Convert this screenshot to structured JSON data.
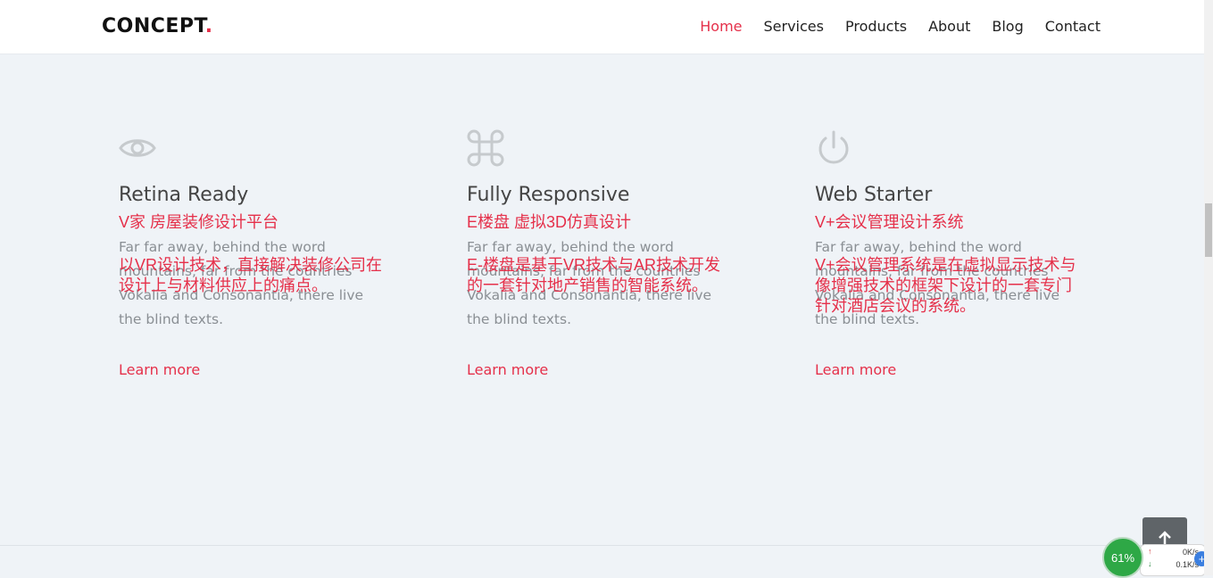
{
  "navbar": {
    "logo_text": "CONCEPT",
    "logo_dot": ".",
    "links": [
      "Home",
      "Services",
      "Products",
      "About",
      "Blog",
      "Contact"
    ],
    "active": "Home"
  },
  "features": [
    {
      "icon": "eye-icon",
      "title": "Retina Ready",
      "cn_title": "V家 房屋装修设计平台",
      "desc": "Far far away, behind the word mountains, far from the countries Vokalia and Consonantia, there live the blind texts.",
      "cn_desc": "以VR设计技术，直接解决装修公司在设计上与材料供应上的痛点。",
      "link": "Learn more"
    },
    {
      "icon": "command-icon",
      "title": "Fully Responsive",
      "cn_title": "E楼盘 虚拟3D仿真设计",
      "desc": "Far far away, behind the word mountains, far from the countries Vokalia and Consonantia, there live the blind texts.",
      "cn_desc": "E-楼盘是基于VR技术与AR技术开发的一套针对地产销售的智能系统。",
      "link": "Learn more"
    },
    {
      "icon": "power-icon",
      "title": "Web Starter",
      "cn_title": "V+会议管理设计系统",
      "desc": "Far far away, behind the word mountains, far from the countries Vokalia and Consonantia, there live the blind texts.",
      "cn_desc": "V+会议管理系统是在虚拟显示技术与像增强技术的框架下设计的一套专门针对酒店会议的系统。",
      "link": "Learn more"
    }
  ],
  "widget": {
    "percent": "61%",
    "upload": "0K/s",
    "download": "0.1K/s"
  },
  "colors": {
    "accent": "#e5304a",
    "background": "#eff3f7",
    "icon": "#c6cacd"
  }
}
